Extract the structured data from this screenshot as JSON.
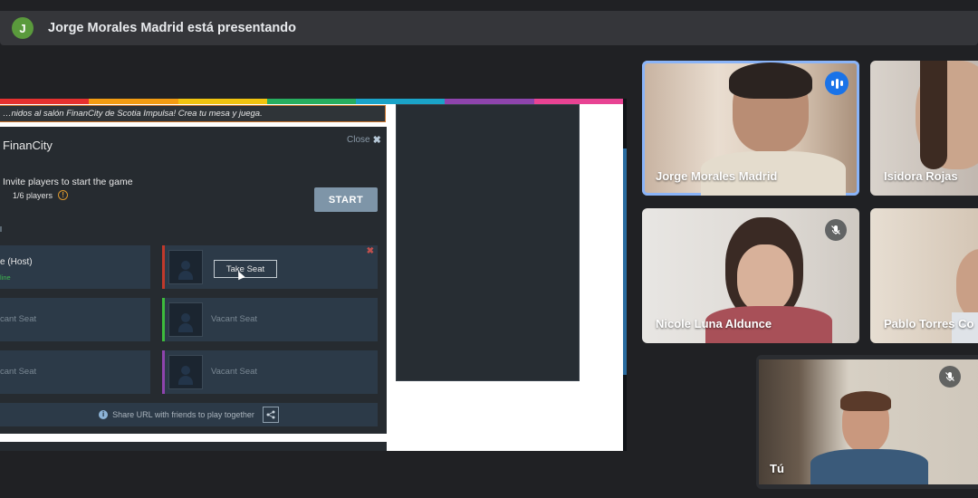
{
  "topbar": {
    "avatar_initial": "J",
    "presenting_text": "Jorge Morales Madrid está presentando"
  },
  "shared_screen": {
    "welcome_banner": "…nidos al salón FinanCity de Scotia Impulsa! Crea tu mesa y juega.",
    "panel_title": "FinanCity",
    "close_label": "Close",
    "invite_text": "Invite players to start the game",
    "players_count": "1/6 players",
    "start_button": "START",
    "seats": {
      "host_name": "e (Host)",
      "host_status": "line",
      "take_seat": "Take Seat",
      "vacant_left_1": "cant Seat",
      "vacant_left_2": "cant Seat",
      "vacant_right_1": "Vacant Seat",
      "vacant_right_2": "Vacant Seat"
    },
    "share_url_text": "Share URL with friends to play together",
    "rainbow_colors": [
      "#e6312f",
      "#f39c12",
      "#f1c40f",
      "#27ae60",
      "#1aa3c8",
      "#8e44ad",
      "#e84393"
    ],
    "seat_colors": {
      "red": "#c0392b",
      "green": "#3dbb3d",
      "purple": "#8e44ad"
    }
  },
  "participants": [
    {
      "name": "Jorge Morales Madrid",
      "status": "speaking"
    },
    {
      "name": "Isidora Rojas",
      "status": ""
    },
    {
      "name": "Nicole Luna Aldunce",
      "status": "muted"
    },
    {
      "name": "Pablo Torres Co",
      "status": ""
    },
    {
      "name": "Tú",
      "status": "muted"
    }
  ],
  "accent_color": "#8ab4f8"
}
